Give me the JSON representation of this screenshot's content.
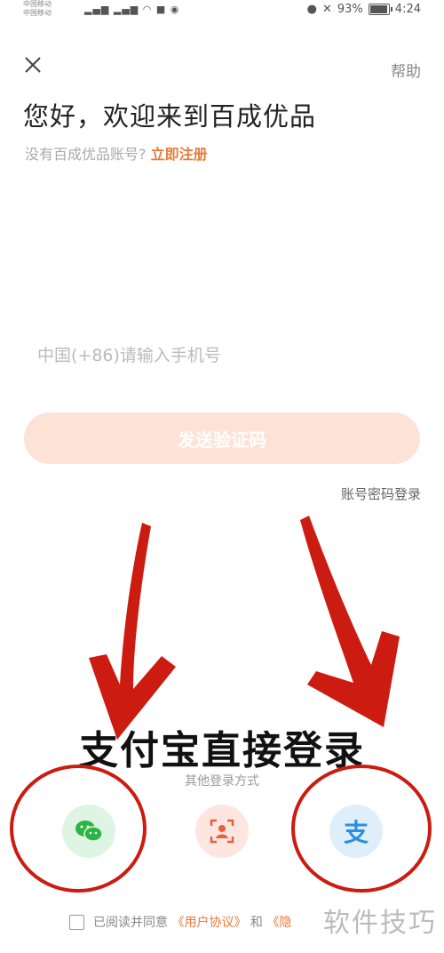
{
  "status_bar": {
    "carrier_line1": "中国移动",
    "carrier_line2": "中国移动",
    "battery": "93%",
    "time": "4:24"
  },
  "header": {
    "help_label": "帮助"
  },
  "welcome": {
    "title": "您好，欢迎来到百成优品",
    "no_account_text": "没有百成优品账号?",
    "register_link": "立即注册"
  },
  "form": {
    "phone_placeholder": "中国(+86)请输入手机号",
    "phone_value": "",
    "send_code_label": "发送验证码",
    "password_login_label": "账号密码登录"
  },
  "annotation": {
    "overlay_text": "支付宝直接登录"
  },
  "other_login": {
    "label": "其他登录方式",
    "alipay_glyph": "支"
  },
  "agreement": {
    "prefix": "已阅读并同意",
    "user_agreement": "《用户协议》",
    "and": "和",
    "privacy_partial": "《隐"
  },
  "watermark": "软件技巧",
  "colors": {
    "accent": "#e87a3a",
    "button_disabled": "#fde3d6",
    "annotation_red": "#cc1b10"
  }
}
